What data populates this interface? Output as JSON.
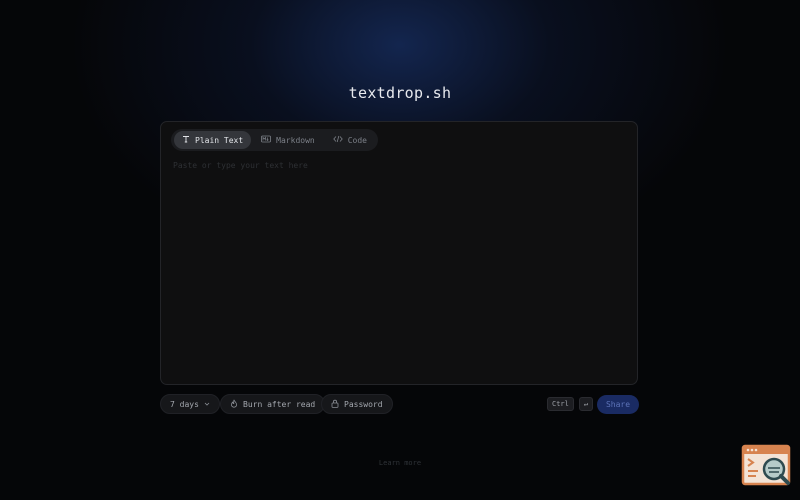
{
  "app": {
    "title": "textdrop.sh"
  },
  "editor": {
    "tabs": [
      {
        "label": "Plain Text",
        "icon": "text-type-icon",
        "active": true
      },
      {
        "label": "Markdown",
        "icon": "markdown-icon",
        "active": false
      },
      {
        "label": "Code",
        "icon": "code-brackets-icon",
        "active": false
      }
    ],
    "placeholder": "Paste or type your text here"
  },
  "options": {
    "expiry_label": "7 days",
    "burn_label": "Burn after read",
    "password_label": "Password"
  },
  "shortcut": {
    "ctrl": "Ctrl",
    "enter": "↵"
  },
  "actions": {
    "share_label": "Share"
  },
  "footer": {
    "link_label": "Learn more"
  },
  "colors": {
    "accent": "#1a2b63",
    "accent_text": "#5d73b8",
    "background": "#050608",
    "panel": "#0f0f10"
  }
}
